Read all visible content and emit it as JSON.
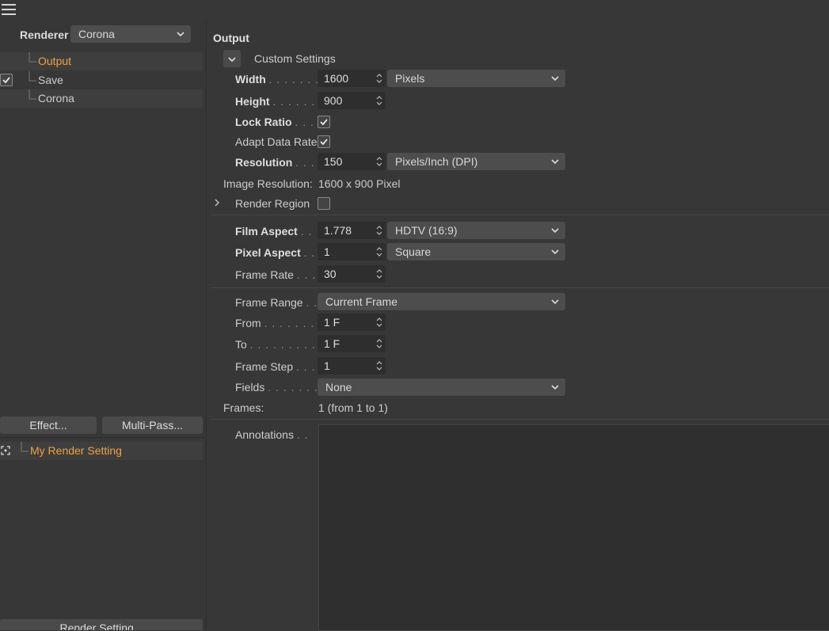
{
  "left": {
    "renderer_label": "Renderer",
    "renderer_value": "Corona",
    "tree": [
      {
        "label": "Output",
        "active": true
      },
      {
        "label": "Save",
        "active": false
      },
      {
        "label": "Corona",
        "active": false
      }
    ],
    "effect_button": "Effect...",
    "multipass_button": "Multi-Pass...",
    "render_setting_item": "My Render Setting",
    "bottom_button": "Render Setting..."
  },
  "output": {
    "title": "Output",
    "custom_settings": "Custom Settings",
    "width_label": "Width",
    "width_value": "1600",
    "width_unit": "Pixels",
    "height_label": "Height",
    "height_value": "900",
    "lock_ratio_label": "Lock Ratio",
    "lock_ratio_checked": true,
    "adapt_data_rate_label": "Adapt Data Rate",
    "adapt_data_rate_checked": true,
    "resolution_label": "Resolution",
    "resolution_value": "150",
    "resolution_unit": "Pixels/Inch (DPI)",
    "image_resolution_label": "Image Resolution:",
    "image_resolution_value": "1600 x 900 Pixel",
    "render_region_label": "Render Region",
    "render_region_checked": false,
    "film_aspect_label": "Film Aspect",
    "film_aspect_value": "1.778",
    "film_aspect_preset": "HDTV (16:9)",
    "pixel_aspect_label": "Pixel Aspect",
    "pixel_aspect_value": "1",
    "pixel_aspect_preset": "Square",
    "frame_rate_label": "Frame Rate",
    "frame_rate_value": "30",
    "frame_range_label": "Frame Range",
    "frame_range_value": "Current Frame",
    "from_label": "From",
    "from_value": "1 F",
    "to_label": "To",
    "to_value": "1 F",
    "frame_step_label": "Frame Step",
    "frame_step_value": "1",
    "fields_label": "Fields",
    "fields_value": "None",
    "frames_label": "Frames:",
    "frames_value": "1 (from 1 to 1)",
    "annotations_label": "Annotations"
  }
}
